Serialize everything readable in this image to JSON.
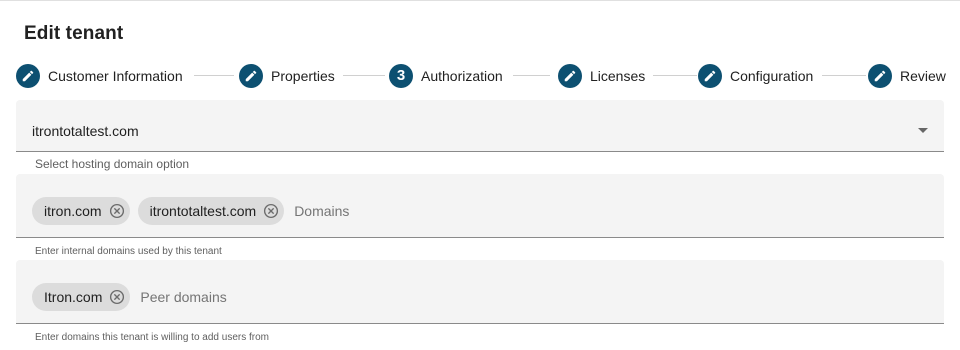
{
  "dialog": {
    "title": "Edit tenant"
  },
  "stepper": {
    "steps": [
      {
        "label": "Customer Information",
        "icon": "pencil-icon",
        "marker": ""
      },
      {
        "label": "Properties",
        "icon": "pencil-icon",
        "marker": ""
      },
      {
        "label": "Authorization",
        "icon": "",
        "marker": "3"
      },
      {
        "label": "Licenses",
        "icon": "pencil-icon",
        "marker": ""
      },
      {
        "label": "Configuration",
        "icon": "pencil-icon",
        "marker": ""
      },
      {
        "label": "Review",
        "icon": "pencil-icon",
        "marker": ""
      }
    ],
    "accent_color": "#0d5071"
  },
  "hosting_domain": {
    "value": "itrontotaltest.com",
    "hint": "Select hosting domain option"
  },
  "internal_domains": {
    "chips": [
      "itron.com",
      "itrontotaltest.com"
    ],
    "placeholder": "Domains",
    "hint": "Enter internal domains used by this tenant"
  },
  "peer_domains": {
    "chips": [
      "Itron.com"
    ],
    "placeholder": "Peer domains",
    "hint": "Enter domains this tenant is willing to add users from"
  }
}
